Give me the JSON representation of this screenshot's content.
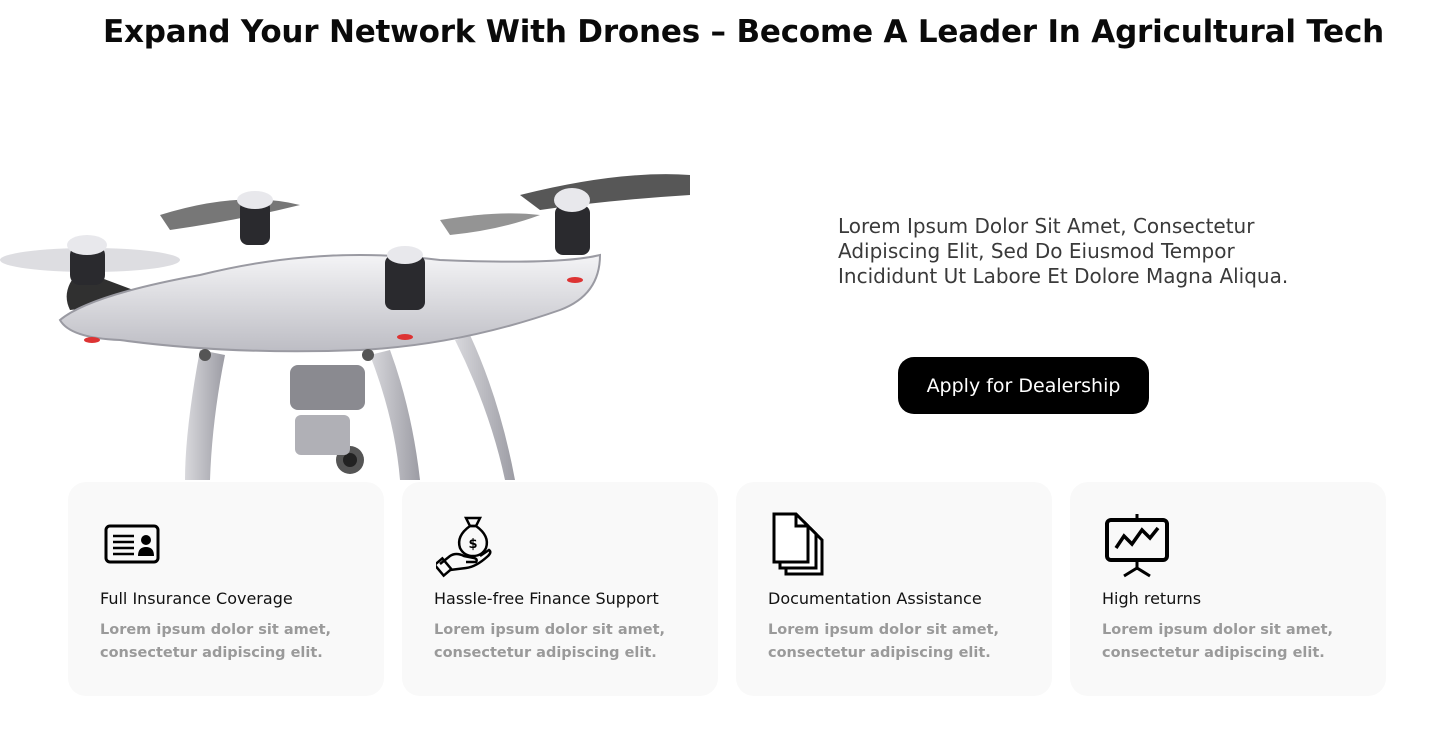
{
  "hero": {
    "title": "Expand Your Network With Drones – Become A Leader In Agricultural Tech",
    "description": "Lorem Ipsum Dolor Sit Amet, Consectetur Adipiscing Elit, Sed Do Eiusmod Tempor Incididunt Ut Labore Et Dolore Magna Aliqua.",
    "cta_label": "Apply for Dealership",
    "image": "drone-image"
  },
  "features": [
    {
      "icon": "id-card-icon",
      "title": "Full Insurance Coverage",
      "description": "Lorem ipsum dolor sit amet, consectetur adipiscing elit."
    },
    {
      "icon": "money-bag-hand-icon",
      "title": "Hassle-free Finance Support",
      "description": "Lorem ipsum dolor sit amet, consectetur adipiscing elit."
    },
    {
      "icon": "documents-icon",
      "title": "Documentation Assistance",
      "description": "Lorem ipsum dolor sit amet, consectetur adipiscing elit."
    },
    {
      "icon": "presentation-chart-icon",
      "title": "High returns",
      "description": "Lorem ipsum dolor sit amet, consectetur adipiscing elit."
    }
  ],
  "colors": {
    "button_bg": "#000000",
    "card_bg": "#f9f9f9",
    "muted_text": "#9a9a9a"
  }
}
